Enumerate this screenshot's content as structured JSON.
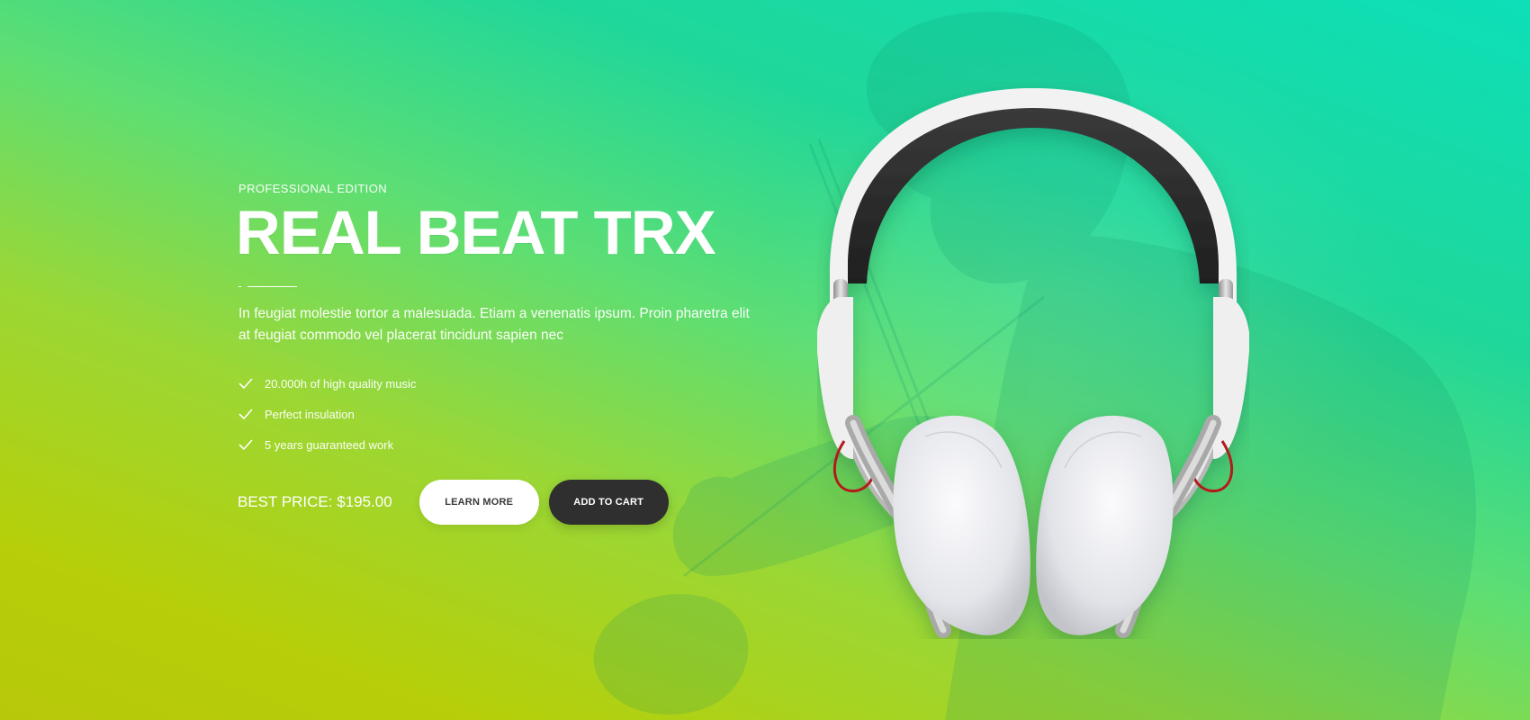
{
  "hero": {
    "eyebrow": "PROFESSIONAL EDITION",
    "title": "REAL BEAT TRX",
    "description": "In feugiat molestie tortor a malesuada. Etiam a venenatis ipsum. Proin pharetra elit at feugiat commodo vel placerat tincidunt sapien nec",
    "features": [
      {
        "text": "20.000h of high quality music",
        "icon": "check-icon"
      },
      {
        "text": "Perfect insulation",
        "icon": "check-icon"
      },
      {
        "text": "5 years guaranteed work",
        "icon": "check-icon"
      }
    ],
    "price_label": "BEST PRICE:",
    "price_value": "$195.00",
    "learn_more_label": "LEARN MORE",
    "add_to_cart_label": "ADD TO CART",
    "product_image": "white-headphones",
    "background_image": "violinist-photo"
  },
  "colors": {
    "gradient_top_right": "#0ddfb8",
    "gradient_bottom_left": "#b7c80a",
    "button_dark": "#2f2f2f",
    "button_light": "#ffffff",
    "text": "#ffffff"
  }
}
